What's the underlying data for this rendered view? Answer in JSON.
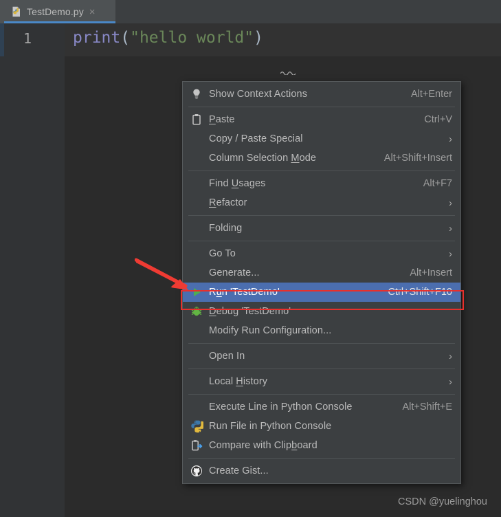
{
  "window": {
    "background_color": "#2b2b2b",
    "panel_color": "#3c3f41"
  },
  "tab": {
    "label": "TestDemo.py",
    "close_label": "×",
    "icon": "python-file-icon",
    "accent_color": "#4a88c7"
  },
  "editor": {
    "line_number": "1",
    "code": {
      "fn": "print",
      "open_paren": "(",
      "string": "\"hello world\"",
      "close_paren": ")"
    }
  },
  "context_menu": {
    "selected_index": 11,
    "highlight_color": "#4b6eaf",
    "items": [
      {
        "label": "Show Context Actions",
        "accel": "Alt+Enter",
        "icon": "lightbulb-icon",
        "arrow": false,
        "mnemonic": ""
      },
      {
        "separator": true
      },
      {
        "label": "Paste",
        "accel": "Ctrl+V",
        "icon": "clipboard-icon",
        "arrow": false,
        "mnemonic": "P"
      },
      {
        "label": "Copy / Paste Special",
        "accel": "",
        "icon": "",
        "arrow": true,
        "mnemonic": ""
      },
      {
        "label": "Column Selection Mode",
        "accel": "Alt+Shift+Insert",
        "icon": "",
        "arrow": false,
        "mnemonic": "M"
      },
      {
        "separator": true
      },
      {
        "label": "Find Usages",
        "accel": "Alt+F7",
        "icon": "",
        "arrow": false,
        "mnemonic": "U"
      },
      {
        "label": "Refactor",
        "accel": "",
        "icon": "",
        "arrow": true,
        "mnemonic": "R"
      },
      {
        "separator": true
      },
      {
        "label": "Folding",
        "accel": "",
        "icon": "",
        "arrow": true,
        "mnemonic": ""
      },
      {
        "separator": true
      },
      {
        "label": "Go To",
        "accel": "",
        "icon": "",
        "arrow": true,
        "mnemonic": ""
      },
      {
        "label": "Generate...",
        "accel": "Alt+Insert",
        "icon": "",
        "arrow": false,
        "mnemonic": ""
      },
      {
        "label": "Run 'TestDemo'",
        "accel": "Ctrl+Shift+F10",
        "icon": "run-play-icon",
        "arrow": false,
        "mnemonic": "u",
        "selected": true
      },
      {
        "label": "Debug 'TestDemo'",
        "accel": "",
        "icon": "debug-bug-icon",
        "arrow": false,
        "mnemonic": "D"
      },
      {
        "label": "Modify Run Configuration...",
        "accel": "",
        "icon": "",
        "arrow": false,
        "mnemonic": ""
      },
      {
        "separator": true
      },
      {
        "label": "Open In",
        "accel": "",
        "icon": "",
        "arrow": true,
        "mnemonic": ""
      },
      {
        "separator": true
      },
      {
        "label": "Local History",
        "accel": "",
        "icon": "",
        "arrow": true,
        "mnemonic": "H"
      },
      {
        "separator": true
      },
      {
        "label": "Execute Line in Python Console",
        "accel": "Alt+Shift+E",
        "icon": "",
        "arrow": false,
        "mnemonic": ""
      },
      {
        "label": "Run File in Python Console",
        "accel": "",
        "icon": "python-icon",
        "arrow": false,
        "mnemonic": ""
      },
      {
        "label": "Compare with Clipboard",
        "accel": "",
        "icon": "compare-clipboard-icon",
        "arrow": false,
        "mnemonic": "b"
      },
      {
        "separator": true
      },
      {
        "label": "Create Gist...",
        "accel": "",
        "icon": "github-icon",
        "arrow": false,
        "mnemonic": ""
      }
    ]
  },
  "annotations": {
    "arrow_color": "#ef3b33",
    "box_color": "#e8302c"
  },
  "watermark": {
    "text": "CSDN @yuelinghou"
  }
}
